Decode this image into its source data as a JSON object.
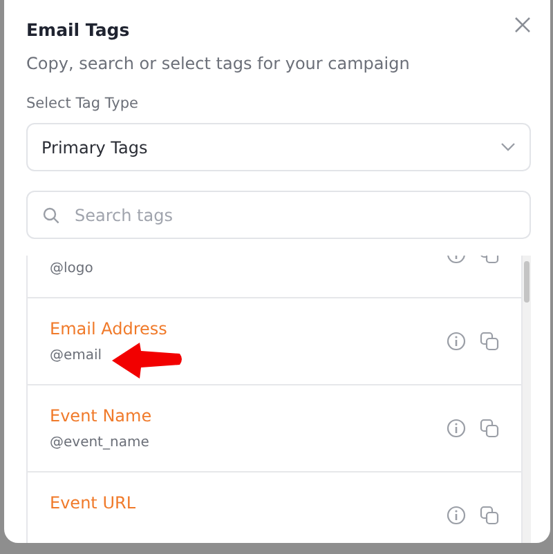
{
  "dialog": {
    "title": "Email Tags",
    "subtitle": "Copy, search or select tags for your campaign"
  },
  "tag_type": {
    "label": "Select Tag Type",
    "value": "Primary Tags"
  },
  "search": {
    "placeholder": "Search tags"
  },
  "tags": [
    {
      "tag": "@logo",
      "pointed_at": false
    },
    {
      "name": "Email Address",
      "tag": "@email",
      "pointed_at": true
    },
    {
      "name": "Event Name",
      "tag": "@event_name",
      "pointed_at": false
    },
    {
      "name": "Event URL",
      "pointed_at": false
    }
  ]
}
